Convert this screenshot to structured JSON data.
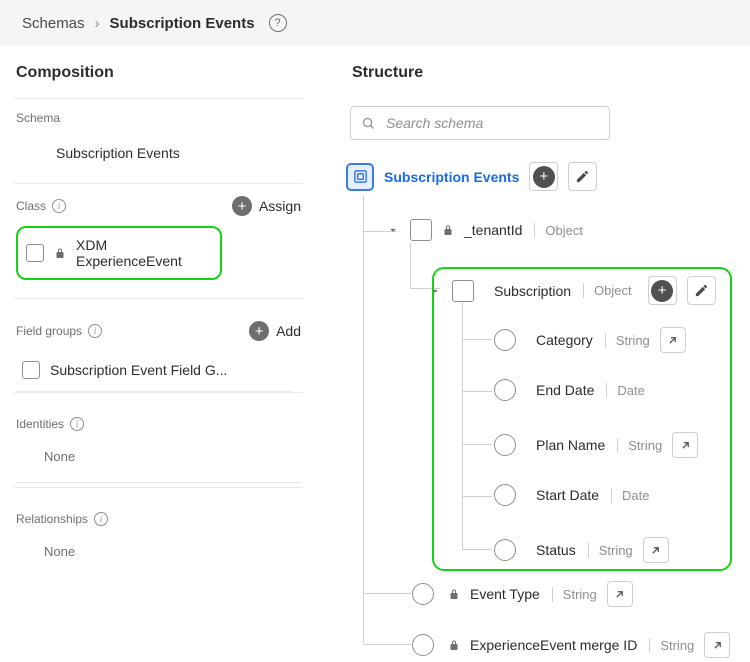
{
  "breadcrumb": {
    "root": "Schemas",
    "current": "Subscription Events",
    "help": "?"
  },
  "left": {
    "title": "Composition",
    "schema": {
      "heading": "Schema",
      "name": "Subscription Events"
    },
    "class": {
      "heading": "Class",
      "assign": "Assign",
      "item": "XDM ExperienceEvent"
    },
    "fieldGroups": {
      "heading": "Field groups",
      "add": "Add",
      "item": "Subscription Event Field G..."
    },
    "identities": {
      "heading": "Identities",
      "none": "None"
    },
    "relationships": {
      "heading": "Relationships",
      "none": "None"
    }
  },
  "right": {
    "title": "Structure",
    "search": {
      "placeholder": "Search schema"
    },
    "root": "Subscription Events",
    "tenant": {
      "name": "_tenantId",
      "type": "Object"
    },
    "subscription": {
      "name": "Subscription",
      "type": "Object",
      "fields": [
        {
          "name": "Category",
          "type": "String",
          "arrow": true
        },
        {
          "name": "End Date",
          "type": "Date",
          "arrow": false
        },
        {
          "name": "Plan Name",
          "type": "String",
          "arrow": true
        },
        {
          "name": "Start Date",
          "type": "Date",
          "arrow": false
        },
        {
          "name": "Status",
          "type": "String",
          "arrow": true
        }
      ]
    },
    "siblings": [
      {
        "name": "Event Type",
        "type": "String",
        "locked": true
      },
      {
        "name": "ExperienceEvent merge ID",
        "type": "String",
        "locked": true
      }
    ]
  }
}
